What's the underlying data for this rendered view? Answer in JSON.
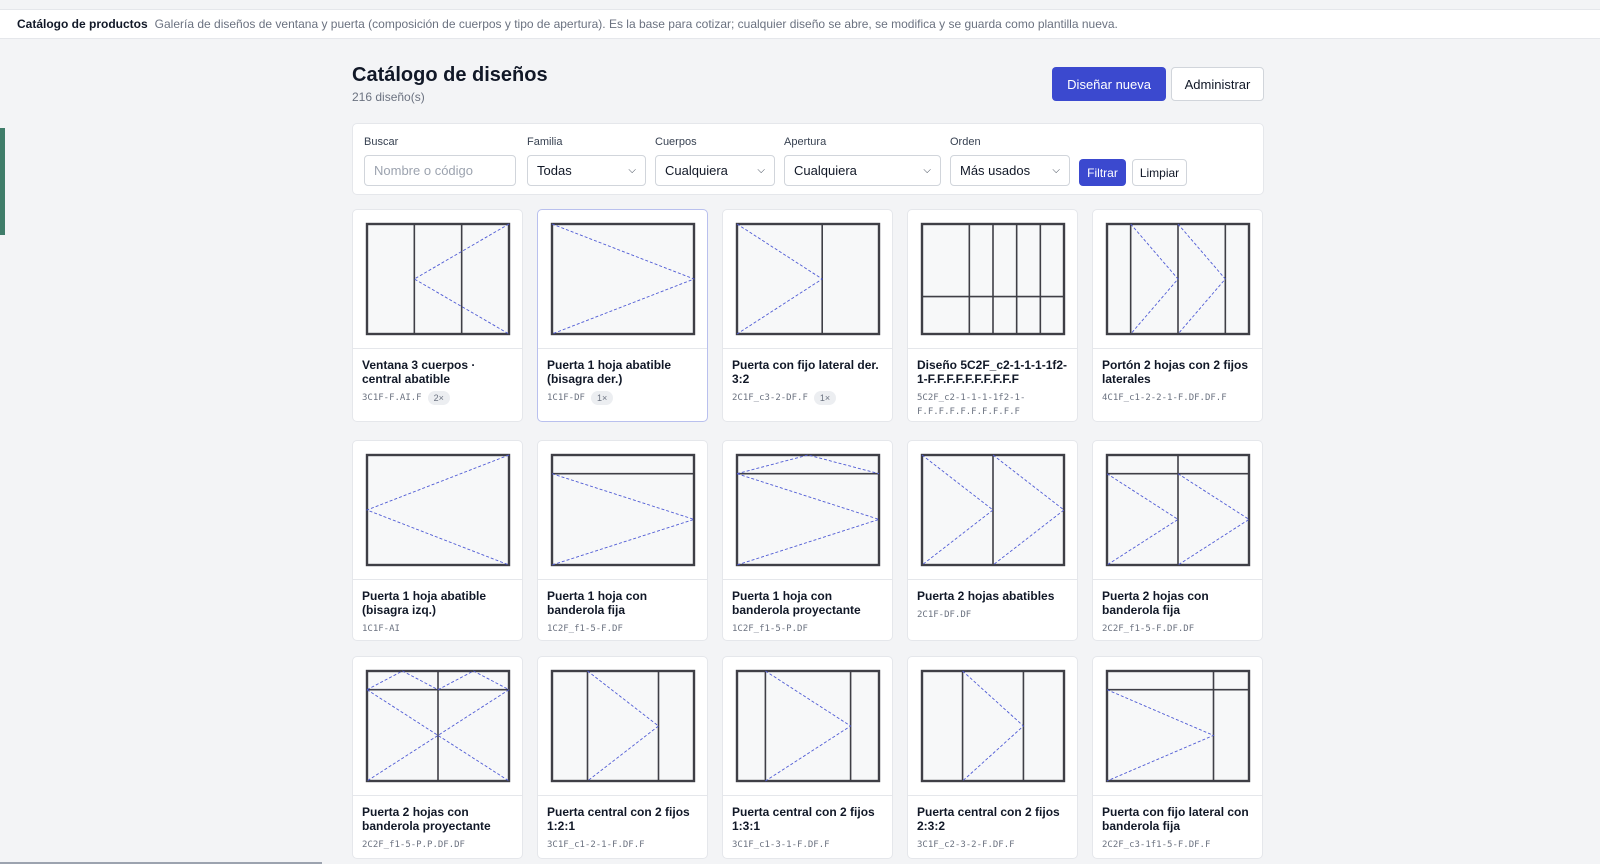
{
  "topbar": {
    "title": "Catálogo de productos",
    "description": "Galería de diseños de ventana y puerta (composición de cuerpos y tipo de apertura). Es la base para cotizar; cualquier diseño se abre, se modifica y se guarda como plantilla nueva."
  },
  "header": {
    "title": "Catálogo de diseños",
    "count": "216 diseño(s)",
    "new_label": "Diseñar nueva",
    "admin_label": "Administrar"
  },
  "filters": {
    "search_label": "Buscar",
    "search_placeholder": "Nombre o código",
    "search_value": "",
    "family_label": "Familia",
    "family_value": "Todas",
    "bodies_label": "Cuerpos",
    "bodies_value": "Cualquiera",
    "opening_label": "Apertura",
    "opening_value": "Cualquiera",
    "order_label": "Orden",
    "order_value": "Más usados",
    "filter_label": "Filtrar",
    "clear_label": "Limpiar"
  },
  "icons": {
    "select": "chevron-down-icon"
  },
  "colors": {
    "accent": "#3b49cf",
    "frame": "#3f3f46",
    "opening": "#4f5bd5"
  },
  "cards": [
    {
      "name": "Ventana 3 cuerpos · central abatible",
      "code": "3C1F-F.AI.F",
      "badge": "2×",
      "selected": false
    },
    {
      "name": "Puerta 1 hoja abatible (bisagra der.)",
      "code": "1C1F-DF",
      "badge": "1×",
      "selected": true
    },
    {
      "name": "Puerta con fijo lateral der. 3:2",
      "code": "2C1F_c3-2-DF.F",
      "badge": "1×",
      "selected": false
    },
    {
      "name": "Diseño 5C2F_c2-1-1-1-1f2-1-F.F.F.F.F.F.F.F.F.F",
      "code": "5C2F_c2-1-1-1-1f2-1-F.F.F.F.F.F.F.F.F.F",
      "badge": "",
      "selected": false
    },
    {
      "name": "Portón 2 hojas con 2 fijos laterales",
      "code": "4C1F_c1-2-2-1-F.DF.DF.F",
      "badge": "",
      "selected": false
    },
    {
      "name": "Puerta 1 hoja abatible (bisagra izq.)",
      "code": "1C1F-AI",
      "badge": "",
      "selected": false
    },
    {
      "name": "Puerta 1 hoja con banderola fija",
      "code": "1C2F_f1-5-F.DF",
      "badge": "",
      "selected": false
    },
    {
      "name": "Puerta 1 hoja con banderola proyectante",
      "code": "1C2F_f1-5-P.DF",
      "badge": "",
      "selected": false
    },
    {
      "name": "Puerta 2 hojas abatibles",
      "code": "2C1F-DF.DF",
      "badge": "",
      "selected": false
    },
    {
      "name": "Puerta 2 hojas con banderola fija",
      "code": "2C2F_f1-5-F.DF.DF",
      "badge": "",
      "selected": false
    },
    {
      "name": "Puerta 2 hojas con banderola proyectante",
      "code": "2C2F_f1-5-P.P.DF.DF",
      "badge": "",
      "selected": false
    },
    {
      "name": "Puerta central con 2 fijos 1:2:1",
      "code": "3C1F_c1-2-1-F.DF.F",
      "badge": "",
      "selected": false
    },
    {
      "name": "Puerta central con 2 fijos 1:3:1",
      "code": "3C1F_c1-3-1-F.DF.F",
      "badge": "",
      "selected": false
    },
    {
      "name": "Puerta central con 2 fijos 2:3:2",
      "code": "3C1F_c2-3-2-F.DF.F",
      "badge": "",
      "selected": false
    },
    {
      "name": "Puerta con fijo lateral con banderola fija",
      "code": "2C2F_c3-1f1-5-F.DF.F",
      "badge": "",
      "selected": false
    }
  ]
}
